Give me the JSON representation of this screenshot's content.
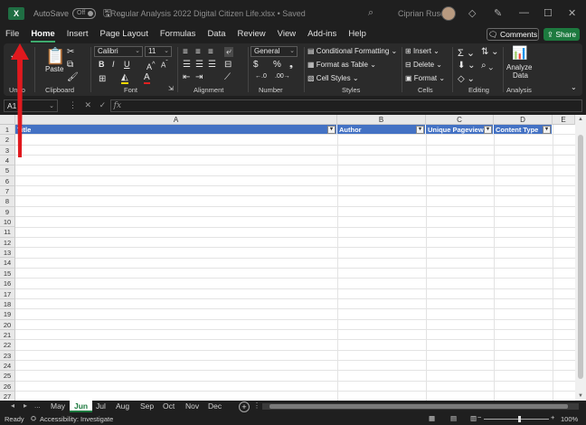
{
  "titlebar": {
    "app_icon": "excel-logo-icon",
    "autosave_label": "AutoSave",
    "autosave_state": "Off",
    "filename": "Regular Analysis 2022 Digital Citizen Life.xlsx • Saved",
    "user_name": "Ciprian Rusen"
  },
  "menu": {
    "items": [
      "File",
      "Home",
      "Insert",
      "Page Layout",
      "Formulas",
      "Data",
      "Review",
      "View",
      "Add-ins",
      "Help"
    ],
    "active": "Home",
    "comments_label": "Comments",
    "share_label": "Share"
  },
  "ribbon": {
    "groups": {
      "undo": "Undo",
      "clipboard": "Clipboard",
      "font": "Font",
      "alignment": "Alignment",
      "number": "Number",
      "styles": "Styles",
      "cells": "Cells",
      "editing": "Editing",
      "analysis": "Analysis"
    },
    "paste_label": "Paste",
    "font_name": "Calibri",
    "font_size": "11",
    "number_format": "General",
    "conditional_formatting": "Conditional Formatting",
    "format_as_table": "Format as Table",
    "cell_styles": "Cell Styles",
    "insert": "Insert",
    "delete": "Delete",
    "format": "Format",
    "analyze_data_line1": "Analyze",
    "analyze_data_line2": "Data"
  },
  "formula_bar": {
    "name_box": "A1",
    "fx": "fx",
    "content": ""
  },
  "sheet": {
    "columns": [
      "A",
      "B",
      "C",
      "D",
      "E"
    ],
    "rows": [
      1,
      2,
      3,
      4,
      5,
      6,
      7,
      8,
      9,
      10,
      11,
      12,
      13,
      14,
      15,
      16,
      17,
      18,
      19,
      20,
      21,
      22,
      23,
      24,
      25,
      26,
      27
    ],
    "header_cells": [
      "Title",
      "Author",
      "Unique Pageviews",
      "Content Type"
    ]
  },
  "sheet_tabs": {
    "tabs": [
      "May",
      "Jun",
      "Jul",
      "Aug",
      "Sep",
      "Oct",
      "Nov",
      "Dec"
    ],
    "active": "Jun",
    "more": "..."
  },
  "status": {
    "ready": "Ready",
    "accessibility": "Accessibility: Investigate",
    "zoom": "100%"
  },
  "colors": {
    "accent_green": "#1d7a3f",
    "header_blue": "#4472c4",
    "annotation_red": "#e0191e"
  }
}
